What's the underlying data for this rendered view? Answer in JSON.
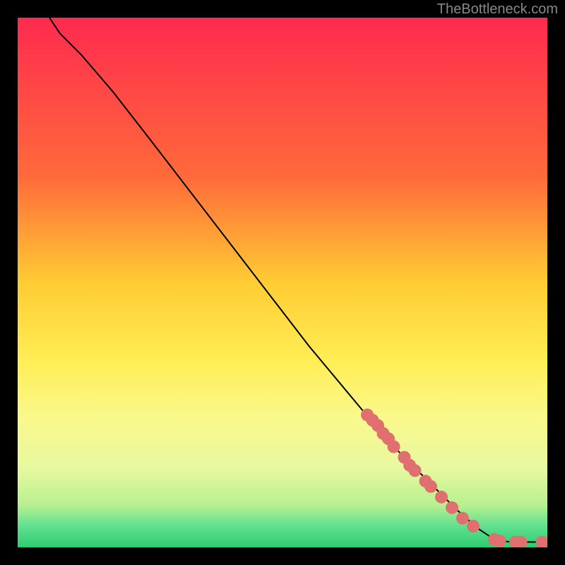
{
  "watermark": "TheBottleneck.com",
  "chart_data": {
    "type": "line",
    "title": "",
    "xlabel": "",
    "ylabel": "",
    "xlim": [
      0,
      100
    ],
    "ylim": [
      0,
      100
    ],
    "gradient_stops": [
      {
        "offset": 0,
        "color": "#ff2a4f"
      },
      {
        "offset": 30,
        "color": "#ff6a3a"
      },
      {
        "offset": 50,
        "color": "#ffcc33"
      },
      {
        "offset": 65,
        "color": "#ffee55"
      },
      {
        "offset": 75,
        "color": "#faf88a"
      },
      {
        "offset": 85,
        "color": "#e8f8a0"
      },
      {
        "offset": 92,
        "color": "#b8f090"
      },
      {
        "offset": 96,
        "color": "#60e090"
      },
      {
        "offset": 100,
        "color": "#2ecc71"
      }
    ],
    "series": [
      {
        "name": "curve",
        "type": "line",
        "color": "#000000",
        "points": [
          {
            "x": 6,
            "y": 100
          },
          {
            "x": 8,
            "y": 97
          },
          {
            "x": 12,
            "y": 93
          },
          {
            "x": 18,
            "y": 86
          },
          {
            "x": 25,
            "y": 77
          },
          {
            "x": 35,
            "y": 64
          },
          {
            "x": 45,
            "y": 51
          },
          {
            "x": 55,
            "y": 38
          },
          {
            "x": 65,
            "y": 26
          },
          {
            "x": 72,
            "y": 18
          },
          {
            "x": 78,
            "y": 12
          },
          {
            "x": 83,
            "y": 7
          },
          {
            "x": 87,
            "y": 3.5
          },
          {
            "x": 90,
            "y": 1.5
          },
          {
            "x": 93,
            "y": 1
          },
          {
            "x": 100,
            "y": 1
          }
        ]
      },
      {
        "name": "highlighted-points",
        "type": "scatter",
        "color": "#e07070",
        "points": [
          {
            "x": 66,
            "y": 25
          },
          {
            "x": 67,
            "y": 24
          },
          {
            "x": 68,
            "y": 23
          },
          {
            "x": 69,
            "y": 21.5
          },
          {
            "x": 70,
            "y": 20.5
          },
          {
            "x": 71,
            "y": 19
          },
          {
            "x": 73,
            "y": 17
          },
          {
            "x": 74,
            "y": 15.5
          },
          {
            "x": 75,
            "y": 14.5
          },
          {
            "x": 77,
            "y": 12.5
          },
          {
            "x": 78,
            "y": 11.5
          },
          {
            "x": 80,
            "y": 9.5
          },
          {
            "x": 82,
            "y": 7.5
          },
          {
            "x": 84,
            "y": 5.5
          },
          {
            "x": 86,
            "y": 4
          },
          {
            "x": 90,
            "y": 1.5
          },
          {
            "x": 91,
            "y": 1.2
          },
          {
            "x": 94,
            "y": 1
          },
          {
            "x": 95,
            "y": 1
          },
          {
            "x": 99,
            "y": 1
          }
        ]
      }
    ]
  }
}
